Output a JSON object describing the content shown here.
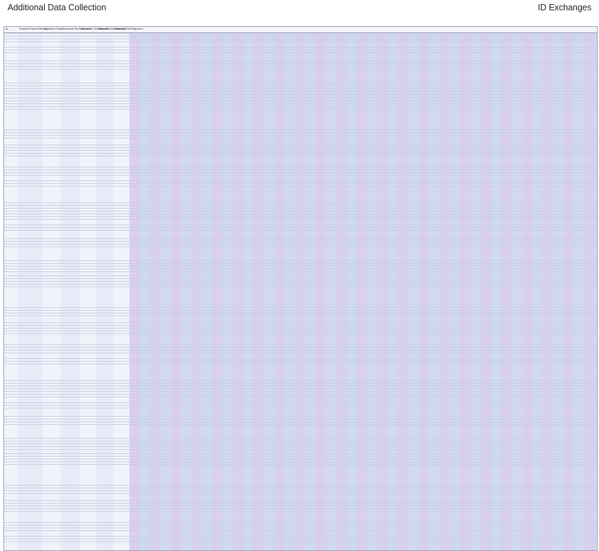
{
  "header": {
    "title": "Additional Data Collection",
    "right_label": "ID Exchanges"
  },
  "table": {
    "columns": [
      "No",
      "Research Prompt Reference",
      "Hypothesis Prompt",
      "Observation Test Response 1",
      "Observation Test Response 2",
      "Observation Test Response 3",
      "Observation Test Response 4"
    ],
    "rows_note": "",
    "stripe_colors": [
      "#cfd9f2",
      "#d9cfee",
      "#cfd9f2",
      "#d9cfee"
    ]
  }
}
